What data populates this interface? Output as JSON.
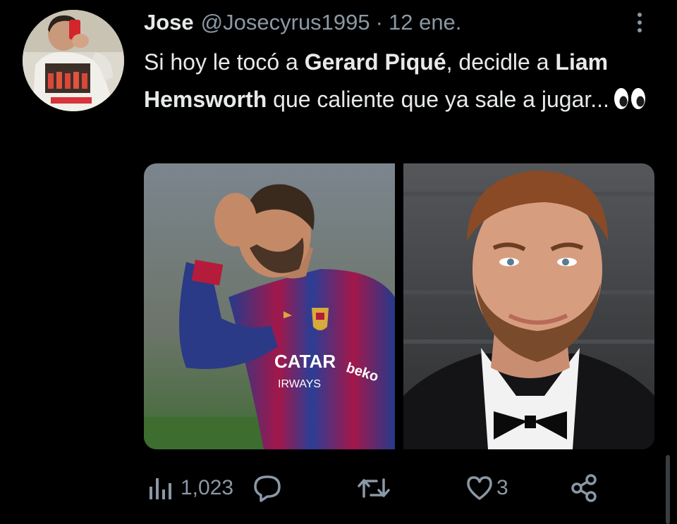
{
  "tweet": {
    "display_name": "Jose",
    "handle": "@Josecyrus1995",
    "separator": "·",
    "date": "12 ene.",
    "text": {
      "part1": "Si hoy le tocó a ",
      "bold1": "Gerard Piqué",
      "part2": ", decidle a ",
      "bold2": "Liam Hemsworth",
      "part3": " que caliente que ya sale a jugar...",
      "emoji": "eyes-emoji"
    },
    "media": {
      "left_image": "footballer-photo",
      "left_shirt_text1": "CATAR",
      "left_shirt_text2": "IRWAYS",
      "left_shirt_sponsor": "beko",
      "right_image": "actor-portrait-photo"
    }
  },
  "actions": {
    "views_icon": "views-bar-chart-icon",
    "views_count": "1,023",
    "reply_icon": "reply-bubble-icon",
    "retweet_icon": "retweet-icon",
    "like_icon": "heart-icon",
    "like_count": "3",
    "share_icon": "share-icon"
  },
  "colors": {
    "background": "#000000",
    "text_primary": "#e7e9ea",
    "text_secondary": "#8b98a5"
  }
}
